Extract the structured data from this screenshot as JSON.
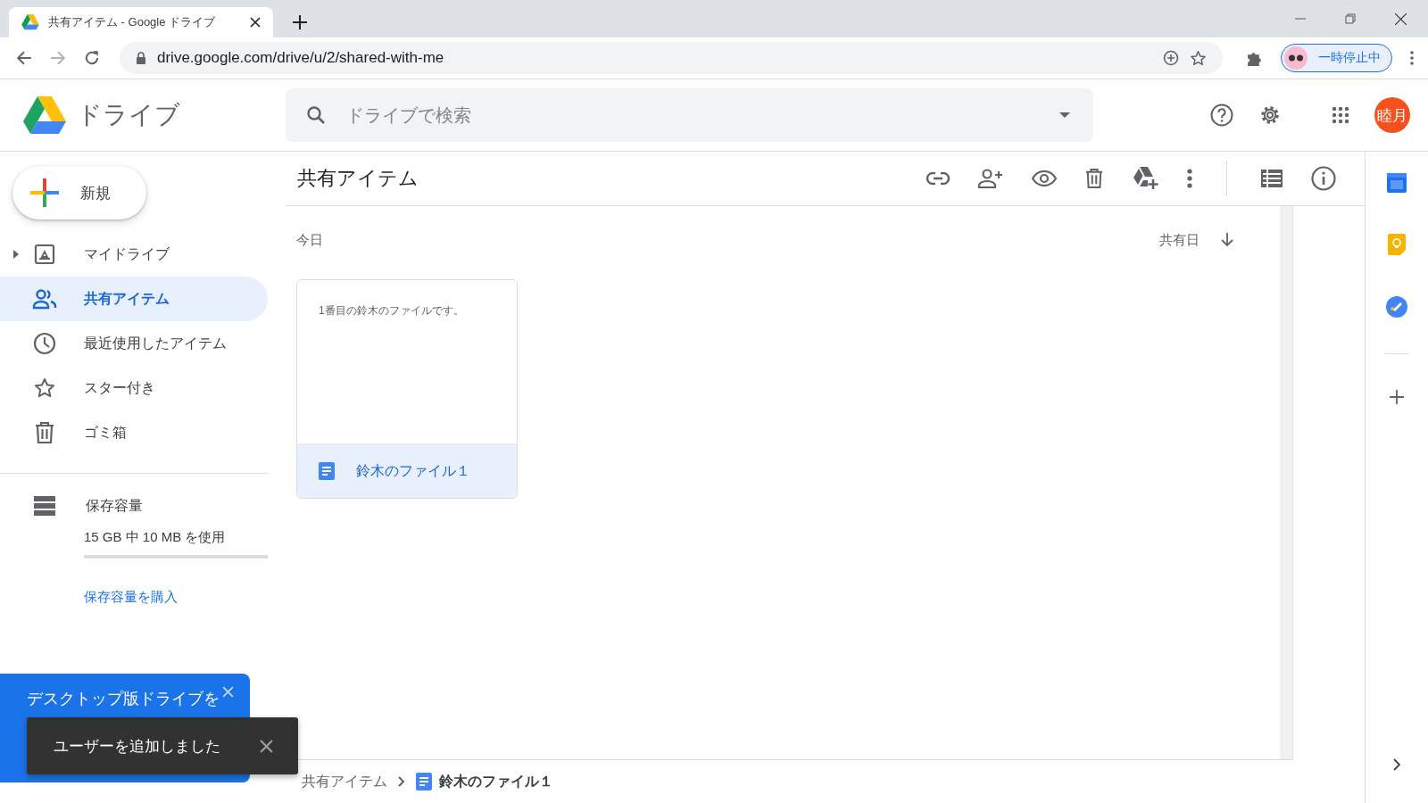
{
  "browser": {
    "tab_title": "共有アイテム - Google ドライブ",
    "url": "drive.google.com/drive/u/2/shared-with-me",
    "profile_status": "一時停止中"
  },
  "app": {
    "name": "ドライブ",
    "search_placeholder": "ドライブで検索",
    "avatar": "睦月"
  },
  "new_button": "新規",
  "nav": [
    {
      "label": "マイドライブ",
      "kind": "drive",
      "has_children": true,
      "selected": false
    },
    {
      "label": "共有アイテム",
      "kind": "people",
      "has_children": false,
      "selected": true
    },
    {
      "label": "最近使用したアイテム",
      "kind": "clock",
      "has_children": false,
      "selected": false
    },
    {
      "label": "スター付き",
      "kind": "star",
      "has_children": false,
      "selected": false
    },
    {
      "label": "ゴミ箱",
      "kind": "trash",
      "has_children": false,
      "selected": false
    }
  ],
  "storage": {
    "label": "保存容量",
    "usage": "15 GB 中 10 MB を使用",
    "level": 0.0,
    "buy_link": "保存容量を購入"
  },
  "content": {
    "title": "共有アイテム",
    "section": "今日",
    "sort_label": "共有日"
  },
  "files": [
    {
      "name": "鈴木のファイル１",
      "preview": "1番目の鈴木のファイルです。",
      "selected": true
    }
  ],
  "banner": {
    "text": "デスクトップ版ドライブを"
  },
  "toast": {
    "text": "ユーザーを追加しました"
  },
  "breadcrumb": [
    {
      "label": "共有アイテム",
      "current": false
    },
    {
      "label": "鈴木のファイル１",
      "current": true
    }
  ]
}
